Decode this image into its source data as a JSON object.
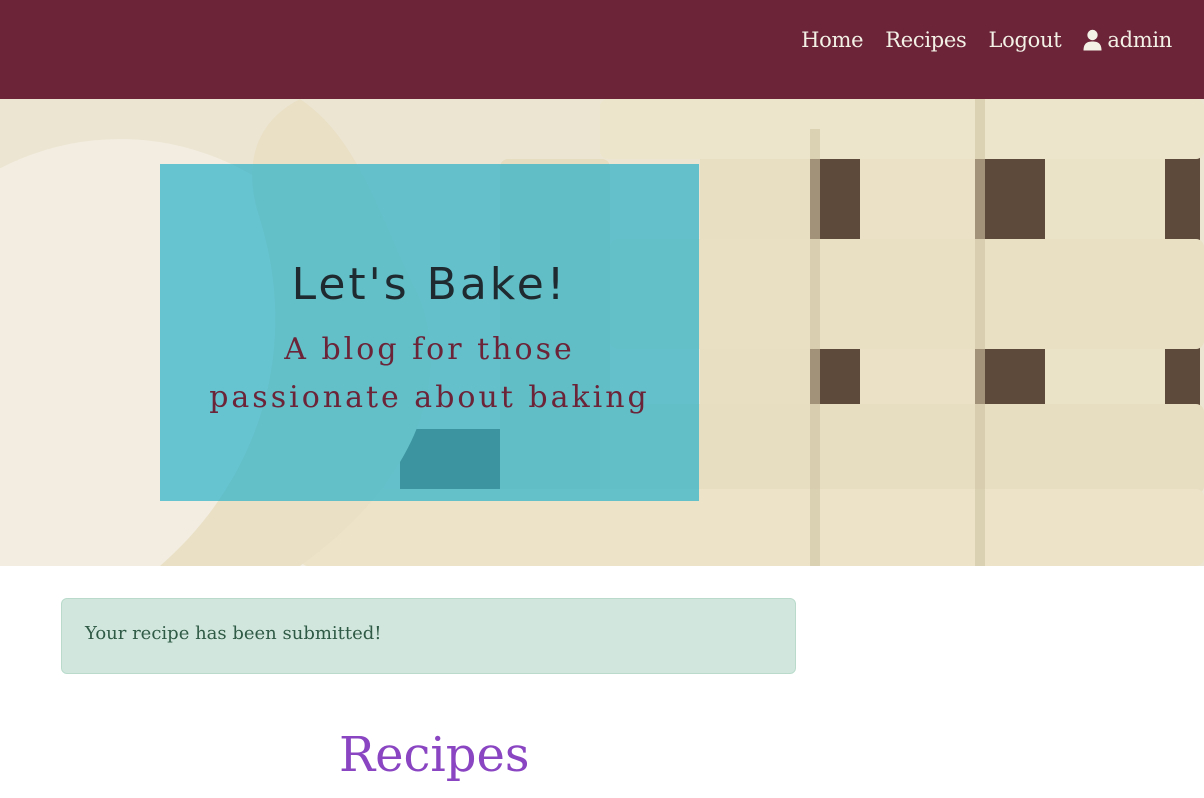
{
  "nav": {
    "items": [
      {
        "label": "Home"
      },
      {
        "label": "Recipes"
      },
      {
        "label": "Logout"
      }
    ],
    "user": {
      "label": "admin",
      "icon": "user-icon"
    }
  },
  "hero": {
    "title": "Let's Bake!",
    "subtitle_line1": "A blog for those",
    "subtitle_line2": "passionate about baking"
  },
  "alert": {
    "message": "Your recipe has been submitted!"
  },
  "section": {
    "heading": "Recipes"
  },
  "colors": {
    "navbar": "#6b2438",
    "hero_overlay": "#2fb3c9",
    "alert_bg": "#d1e7dd",
    "heading": "#8a45c2"
  }
}
